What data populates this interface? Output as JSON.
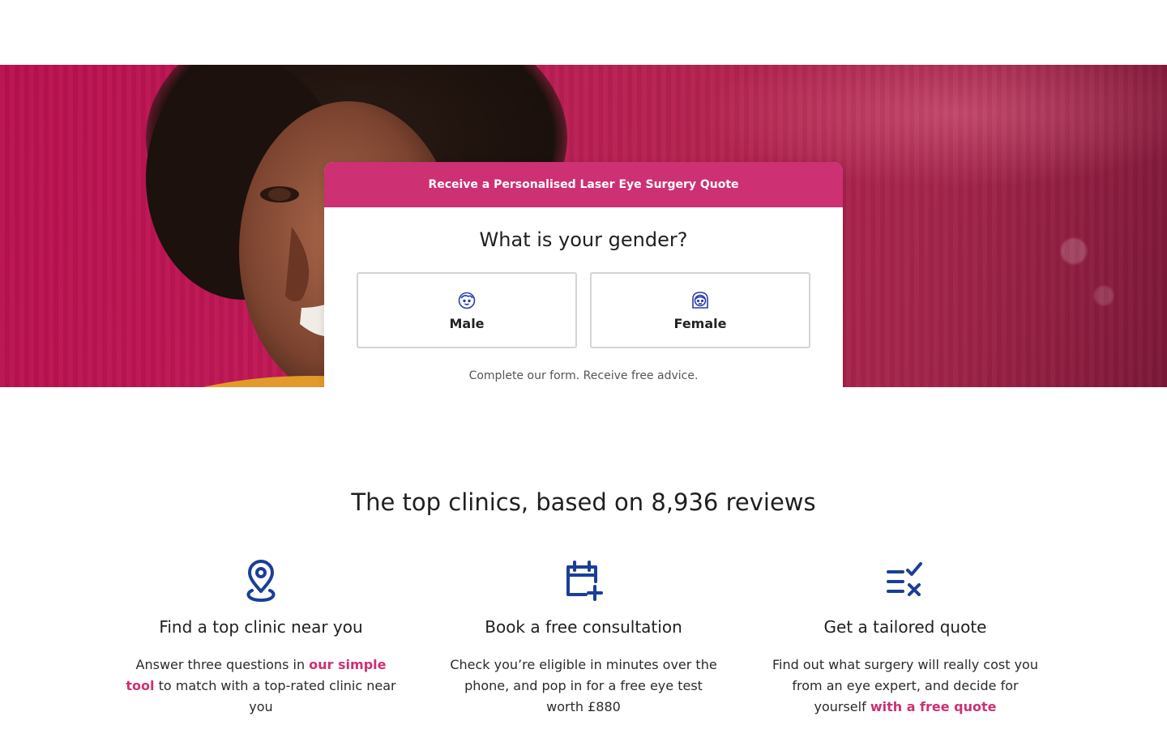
{
  "hero": {
    "card": {
      "header": "Receive a Personalised Laser Eye Surgery Quote",
      "question": "What is your gender?",
      "options": [
        {
          "label": "Male",
          "icon": "male-face-icon"
        },
        {
          "label": "Female",
          "icon": "female-face-icon"
        }
      ],
      "footer": "Complete our form. Receive free advice."
    }
  },
  "features_section": {
    "title": "The top clinics, based on 8,936 reviews",
    "items": [
      {
        "icon": "map-pin-icon",
        "title": "Find a top clinic near you",
        "text_before": "Answer three questions in ",
        "link": "our simple tool",
        "text_after": " to match with a top-rated clinic near you"
      },
      {
        "icon": "calendar-plus-icon",
        "title": "Book a free consultation",
        "text_before": "Check you’re eligible in minutes over the phone, and pop in for a free eye test worth £880",
        "link": "",
        "text_after": ""
      },
      {
        "icon": "list-check-icon",
        "title": "Get a tailored quote",
        "text_before": "Find out what surgery will really cost you from an eye expert, and decide for yourself ",
        "link": "with a free quote",
        "text_after": ""
      }
    ]
  },
  "colors": {
    "accent": "#cd3073",
    "icon_blue": "#1b3f97",
    "hero_bg": "#b8114f"
  }
}
